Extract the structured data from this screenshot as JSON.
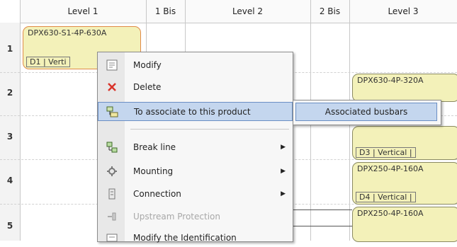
{
  "headers": [
    "Level 1",
    "1 Bis",
    "Level 2",
    "2 Bis",
    "Level 3"
  ],
  "rows": [
    "1",
    "2",
    "3",
    "4",
    "5"
  ],
  "products": [
    {
      "name": "DPX630-S1-4P-630A",
      "sub": "D1 | Verti"
    },
    {
      "name": "DPX630-4P-320A",
      "sub": ""
    },
    {
      "name": "",
      "sub": "D3 | Vertical |"
    },
    {
      "name": "DPX250-4P-160A",
      "sub": "D4 | Vertical |"
    },
    {
      "name": "DPX250-4P-160A",
      "sub": ""
    }
  ],
  "context_menu": {
    "items": [
      {
        "label": "Modify",
        "icon": "modify-icon"
      },
      {
        "label": "Delete",
        "icon": "delete-icon",
        "icon_color": "#d9342b"
      },
      {
        "label": "To associate to this product",
        "icon": "associate-icon",
        "highlighted": true,
        "has_submenu": true
      },
      {
        "label": "Break line",
        "icon": "break-line-icon",
        "has_submenu": true
      },
      {
        "label": "Mounting",
        "icon": "mounting-icon",
        "has_submenu": true
      },
      {
        "label": "Connection",
        "icon": "connection-icon",
        "has_submenu": true
      },
      {
        "label": "Upstream Protection",
        "icon": "upstream-protection-icon",
        "disabled": true
      },
      {
        "label": "Modify the Identification",
        "icon": "identification-icon"
      }
    ]
  },
  "submenu": {
    "item_label": "Associated busbars"
  },
  "colors": {
    "product_fill": "#f3f1b9",
    "selection_border": "#e08a48",
    "highlight": "#c4d6ee"
  }
}
